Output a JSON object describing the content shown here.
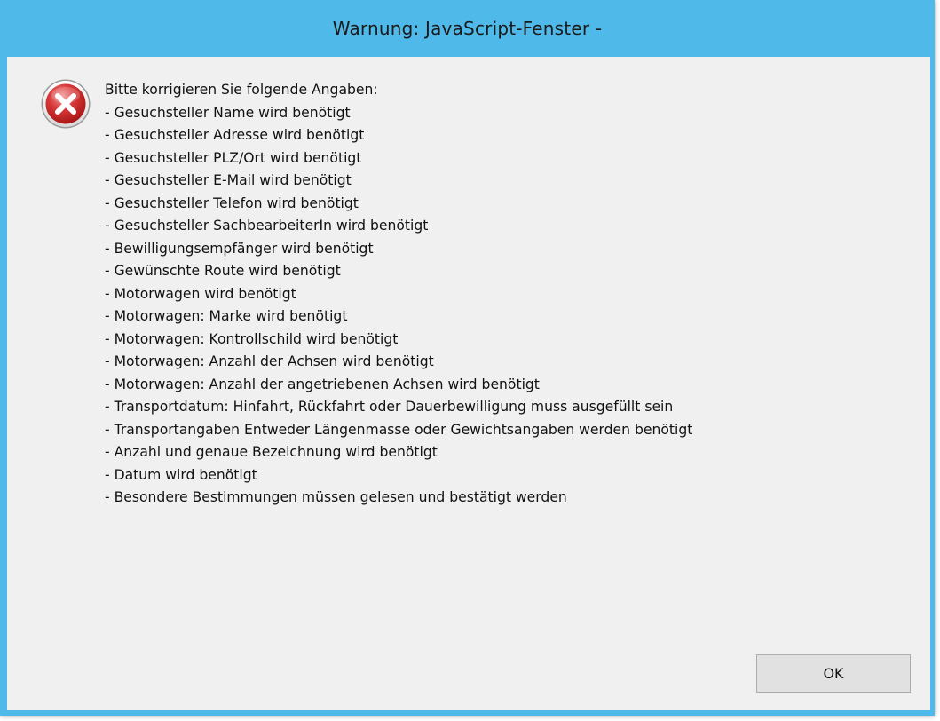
{
  "window": {
    "title": "Warnung: JavaScript-Fenster -"
  },
  "dialog": {
    "icon": "error-icon",
    "accent_color": "#4fb9ea",
    "heading": "Bitte korrigieren Sie folgende Angaben:",
    "errors": [
      "- Gesuchsteller Name wird benötigt",
      "- Gesuchsteller Adresse wird benötigt",
      "- Gesuchsteller PLZ/Ort wird benötigt",
      "- Gesuchsteller E-Mail wird benötigt",
      "- Gesuchsteller Telefon wird benötigt",
      "- Gesuchsteller SachbearbeiterIn wird benötigt",
      "- Bewilligungsempfänger wird benötigt",
      "- Gewünschte Route wird benötigt",
      "- Motorwagen wird benötigt",
      "- Motorwagen: Marke wird benötigt",
      "- Motorwagen: Kontrollschild wird benötigt",
      "- Motorwagen: Anzahl der Achsen wird benötigt",
      "- Motorwagen: Anzahl der angetriebenen Achsen wird benötigt",
      "- Transportdatum: Hinfahrt, Rückfahrt oder Dauerbewilligung muss ausgefüllt sein",
      "- Transportangaben Entweder Längenmasse oder Gewichtsangaben werden benötigt",
      "- Anzahl und genaue Bezeichnung wird benötigt",
      "- Datum wird benötigt",
      "- Besondere Bestimmungen müssen gelesen und bestätigt werden"
    ],
    "ok_label": "OK"
  }
}
